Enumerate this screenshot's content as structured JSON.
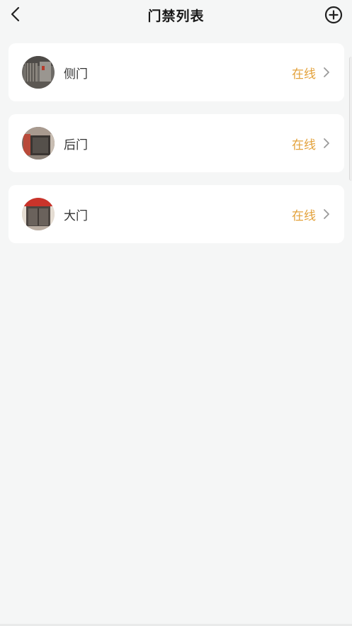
{
  "header": {
    "title": "门禁列表",
    "back_icon": "chevron-left-icon",
    "add_icon": "plus-circle-icon"
  },
  "doors": [
    {
      "name": "侧门",
      "status": "在线",
      "thumb": "side-gate"
    },
    {
      "name": "后门",
      "status": "在线",
      "thumb": "back-door"
    },
    {
      "name": "大门",
      "status": "在线",
      "thumb": "main-gate"
    }
  ],
  "colors": {
    "status_online": "#e3a23c",
    "background": "#f5f6f6",
    "card": "#ffffff"
  }
}
